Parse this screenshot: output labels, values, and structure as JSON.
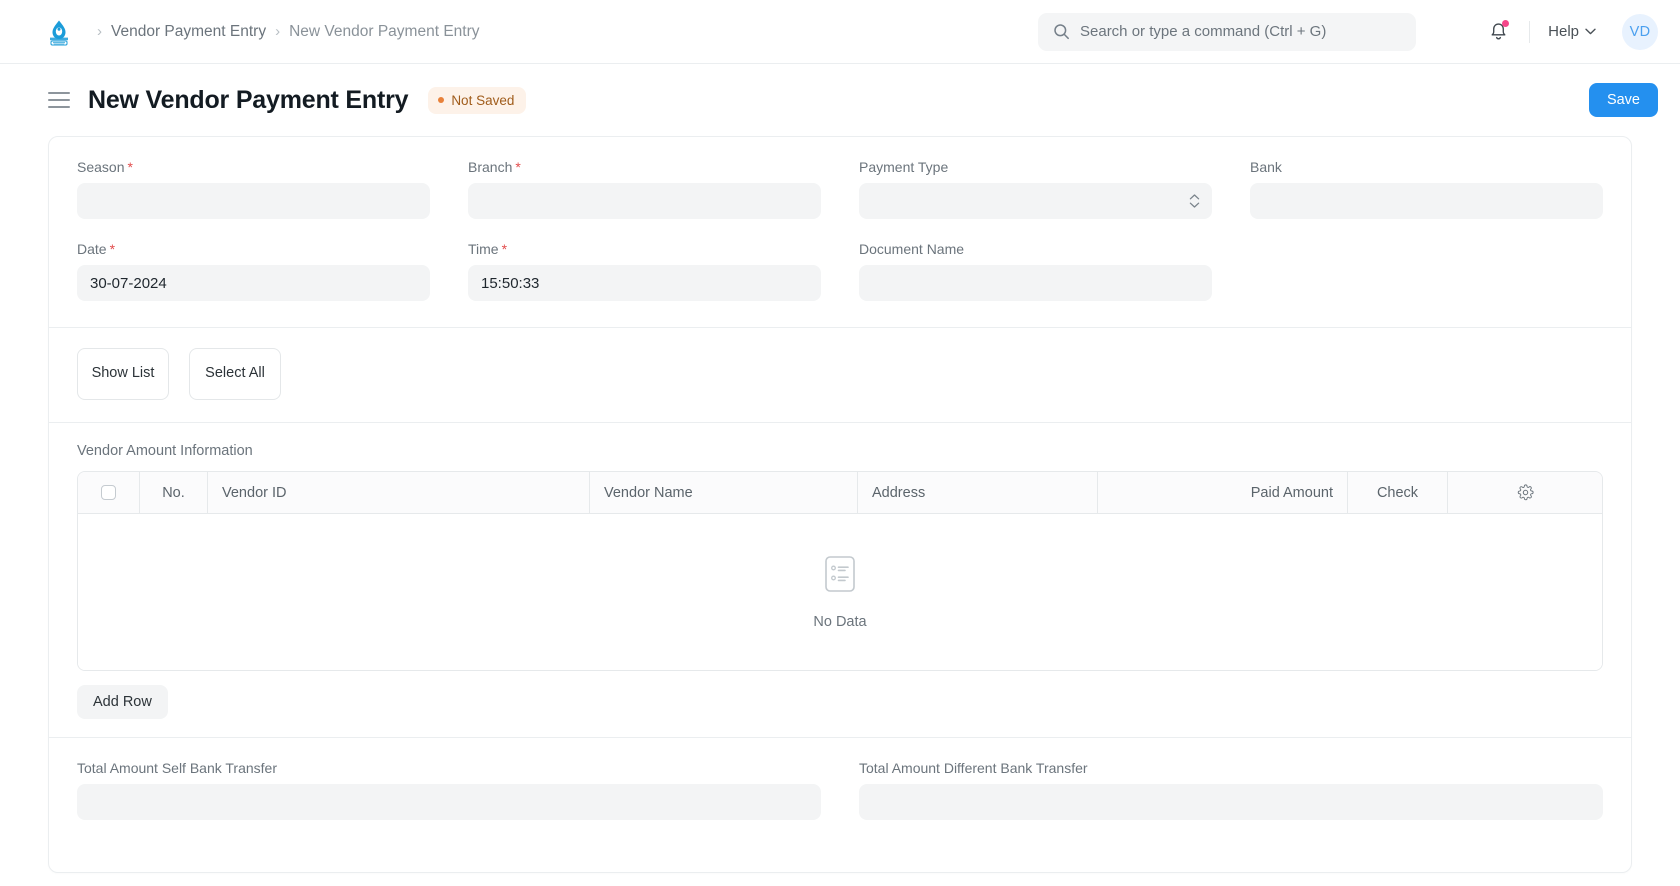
{
  "navbar": {
    "logo_name": "app-logo",
    "breadcrumb": [
      {
        "label": "Vendor Payment Entry",
        "active": false
      },
      {
        "label": "New Vendor Payment Entry",
        "active": true
      }
    ],
    "separator": "›",
    "search": {
      "placeholder": "Search or type a command (Ctrl + G)",
      "value": "",
      "icon": "search-icon"
    },
    "notifications": {
      "icon": "bell-icon",
      "has_unread": true,
      "dot_color": "#f5468a"
    },
    "help": {
      "label": "Help",
      "chevron": "chevron-down-icon"
    },
    "avatar": {
      "initials": "VD",
      "bg": "#e8f2fe",
      "fg": "#4ba0ef"
    }
  },
  "page": {
    "title": "New Vendor Payment Entry",
    "status_badge": {
      "label": "Not Saved",
      "color": "#a05c1b",
      "bg": "#fdf2e9",
      "dot": "#e8813a"
    },
    "save_button": {
      "label": "Save",
      "color": "#2490ef"
    },
    "menu_icon": "hamburger-icon"
  },
  "form": {
    "fields_row1": [
      {
        "label": "Season",
        "required": true,
        "value": "",
        "type": "text"
      },
      {
        "label": "Branch",
        "required": true,
        "value": "",
        "type": "text"
      },
      {
        "label": "Payment Type",
        "required": false,
        "value": "",
        "type": "select"
      },
      {
        "label": "Bank",
        "required": false,
        "value": "",
        "type": "text"
      }
    ],
    "fields_row2": [
      {
        "label": "Date",
        "required": true,
        "value": "30-07-2024",
        "type": "text"
      },
      {
        "label": "Time",
        "required": true,
        "value": "15:50:33",
        "type": "text"
      },
      {
        "label": "Document Name",
        "required": false,
        "value": "",
        "type": "text"
      }
    ],
    "buttons": [
      {
        "label": "Show List"
      },
      {
        "label": "Select All"
      }
    ]
  },
  "table": {
    "title": "Vendor Amount Information",
    "columns": [
      {
        "label": "",
        "key": "select"
      },
      {
        "label": "No.",
        "key": "no"
      },
      {
        "label": "Vendor ID",
        "key": "vendor_id"
      },
      {
        "label": "Vendor Name",
        "key": "vendor_name"
      },
      {
        "label": "Address",
        "key": "address"
      },
      {
        "label": "Paid Amount",
        "key": "paid_amount"
      },
      {
        "label": "Check",
        "key": "check"
      },
      {
        "label": "",
        "key": "settings"
      }
    ],
    "rows": [],
    "empty_state": {
      "label": "No Data",
      "icon": "empty-list-icon"
    },
    "settings_icon": "gear-icon",
    "add_row_button": {
      "label": "Add Row"
    }
  },
  "totals": [
    {
      "label": "Total Amount Self Bank Transfer",
      "value": ""
    },
    {
      "label": "Total Amount Different Bank Transfer",
      "value": ""
    }
  ]
}
